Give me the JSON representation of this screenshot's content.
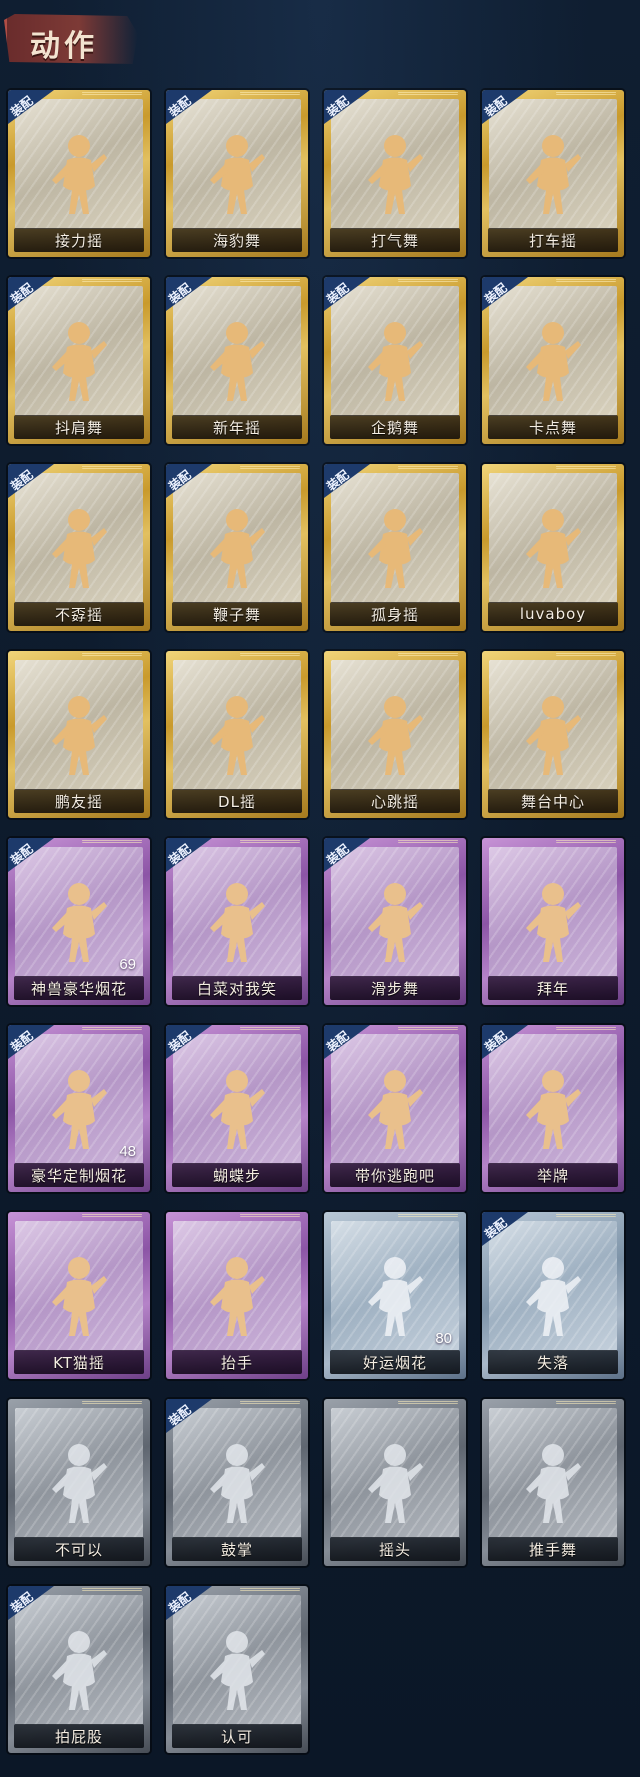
{
  "section": {
    "title": "动作"
  },
  "badge_text": "装配",
  "cards": [
    {
      "label": "接力摇",
      "tier": "gold",
      "equipped": true,
      "count": ""
    },
    {
      "label": "海豹舞",
      "tier": "gold",
      "equipped": true,
      "count": ""
    },
    {
      "label": "打气舞",
      "tier": "gold",
      "equipped": true,
      "count": ""
    },
    {
      "label": "打车摇",
      "tier": "gold",
      "equipped": true,
      "count": ""
    },
    {
      "label": "抖肩舞",
      "tier": "gold",
      "equipped": true,
      "count": ""
    },
    {
      "label": "新年摇",
      "tier": "gold",
      "equipped": true,
      "count": ""
    },
    {
      "label": "企鹅舞",
      "tier": "gold",
      "equipped": true,
      "count": ""
    },
    {
      "label": "卡点舞",
      "tier": "gold",
      "equipped": true,
      "count": ""
    },
    {
      "label": "不孬摇",
      "tier": "gold",
      "equipped": true,
      "count": ""
    },
    {
      "label": "鞭子舞",
      "tier": "gold",
      "equipped": true,
      "count": ""
    },
    {
      "label": "孤身摇",
      "tier": "gold",
      "equipped": true,
      "count": ""
    },
    {
      "label": "luvaboy",
      "tier": "gold",
      "equipped": false,
      "count": ""
    },
    {
      "label": "鹏友摇",
      "tier": "gold",
      "equipped": false,
      "count": ""
    },
    {
      "label": "DL摇",
      "tier": "gold",
      "equipped": false,
      "count": ""
    },
    {
      "label": "心跳摇",
      "tier": "gold",
      "equipped": false,
      "count": ""
    },
    {
      "label": "舞台中心",
      "tier": "gold",
      "equipped": false,
      "count": ""
    },
    {
      "label": "神兽豪华烟花",
      "tier": "purple",
      "equipped": true,
      "count": "69"
    },
    {
      "label": "白菜对我笑",
      "tier": "purple",
      "equipped": true,
      "count": ""
    },
    {
      "label": "滑步舞",
      "tier": "purple",
      "equipped": true,
      "count": ""
    },
    {
      "label": "拜年",
      "tier": "purple",
      "equipped": false,
      "count": ""
    },
    {
      "label": "豪华定制烟花",
      "tier": "purple",
      "equipped": true,
      "count": "48"
    },
    {
      "label": "蝴蝶步",
      "tier": "purple",
      "equipped": true,
      "count": ""
    },
    {
      "label": "带你逃跑吧",
      "tier": "purple",
      "equipped": true,
      "count": ""
    },
    {
      "label": "举牌",
      "tier": "purple",
      "equipped": true,
      "count": ""
    },
    {
      "label": "KT猫摇",
      "tier": "purple",
      "equipped": false,
      "count": ""
    },
    {
      "label": "抬手",
      "tier": "purple",
      "equipped": false,
      "count": ""
    },
    {
      "label": "好运烟花",
      "tier": "blue",
      "equipped": false,
      "count": "80"
    },
    {
      "label": "失落",
      "tier": "blue",
      "equipped": true,
      "count": ""
    },
    {
      "label": "不可以",
      "tier": "gray",
      "equipped": false,
      "count": ""
    },
    {
      "label": "鼓掌",
      "tier": "gray",
      "equipped": true,
      "count": ""
    },
    {
      "label": "摇头",
      "tier": "gray",
      "equipped": false,
      "count": ""
    },
    {
      "label": "推手舞",
      "tier": "gray",
      "equipped": false,
      "count": ""
    },
    {
      "label": "拍屁股",
      "tier": "gray",
      "equipped": true,
      "count": ""
    },
    {
      "label": "认可",
      "tier": "gray",
      "equipped": true,
      "count": ""
    }
  ]
}
